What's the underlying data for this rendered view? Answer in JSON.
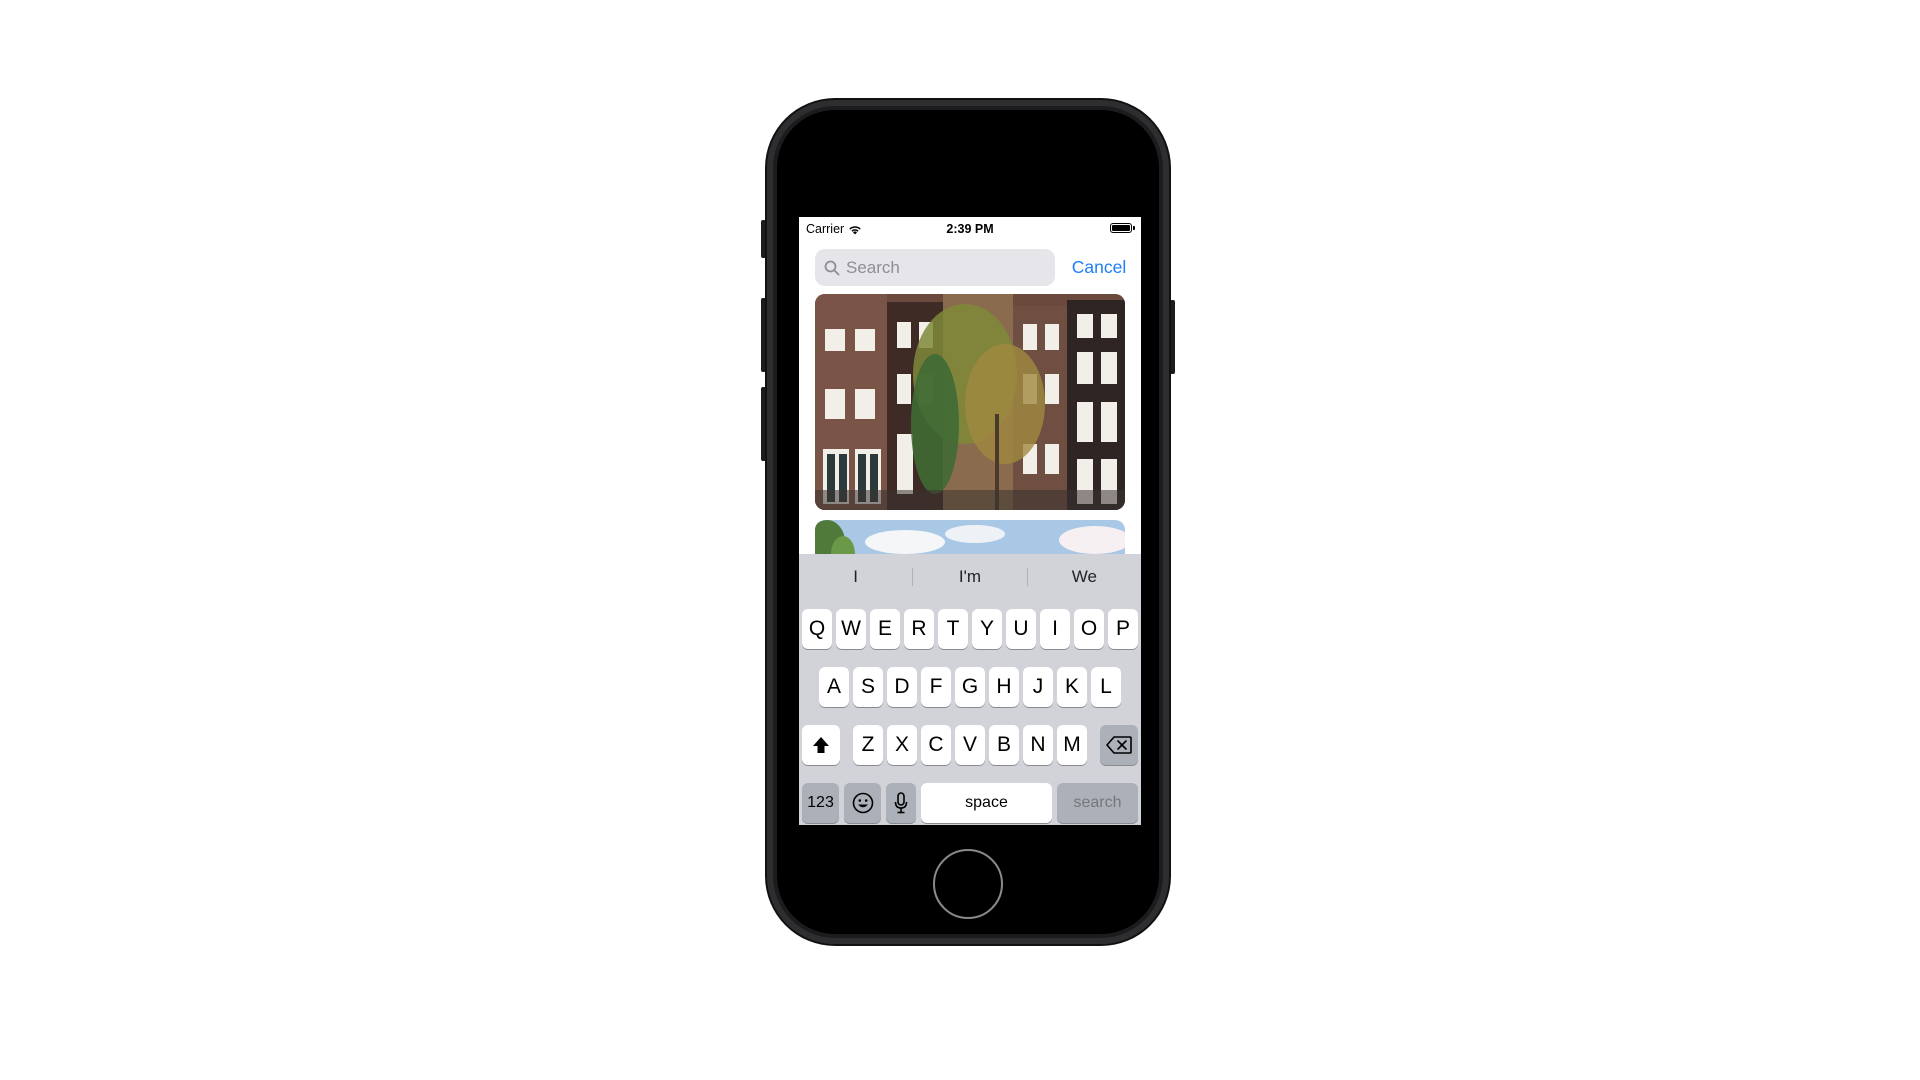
{
  "status_bar": {
    "carrier": "Carrier",
    "time": "2:39 PM",
    "wifi_icon": "wifi-icon",
    "battery_icon": "battery-icon"
  },
  "search": {
    "placeholder": "Search",
    "value": "",
    "cancel_label": "Cancel",
    "accent_color": "#1e7ff5"
  },
  "photos": [
    {
      "subject": "canal-houses-photo"
    },
    {
      "subject": "sky-photo"
    }
  ],
  "keyboard": {
    "suggestions": [
      "I",
      "I'm",
      "We"
    ],
    "row1": [
      "Q",
      "W",
      "E",
      "R",
      "T",
      "Y",
      "U",
      "I",
      "O",
      "P"
    ],
    "row2": [
      "A",
      "S",
      "D",
      "F",
      "G",
      "H",
      "J",
      "K",
      "L"
    ],
    "row3": [
      "Z",
      "X",
      "C",
      "V",
      "B",
      "N",
      "M"
    ],
    "numbers_label": "123",
    "space_label": "space",
    "search_label": "search"
  }
}
